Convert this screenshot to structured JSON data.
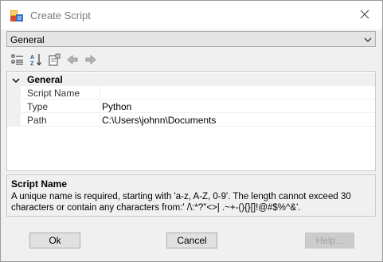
{
  "window": {
    "title": "Create Script",
    "close_icon": "close-icon"
  },
  "category_dropdown": {
    "value": "General"
  },
  "toolbar": {
    "icons": [
      "categorized-icon",
      "alphabetical-sort-icon",
      "property-pages-icon",
      "back-icon",
      "forward-icon"
    ]
  },
  "property_grid": {
    "category": "General",
    "rows": [
      {
        "name": "Script Name",
        "value": ""
      },
      {
        "name": "Type",
        "value": "Python"
      },
      {
        "name": "Path",
        "value": "C:\\Users\\johnn\\Documents"
      }
    ]
  },
  "description": {
    "title": "Script Name",
    "text": "A unique name is required, starting with 'a-z, A-Z, 0-9'. The length cannot exceed 30 characters or contain any characters from:' /\\:*?\"<>| .~+-(){}[]!@#$%^&'."
  },
  "buttons": {
    "ok": "Ok",
    "cancel": "Cancel",
    "help": "Help..."
  }
}
